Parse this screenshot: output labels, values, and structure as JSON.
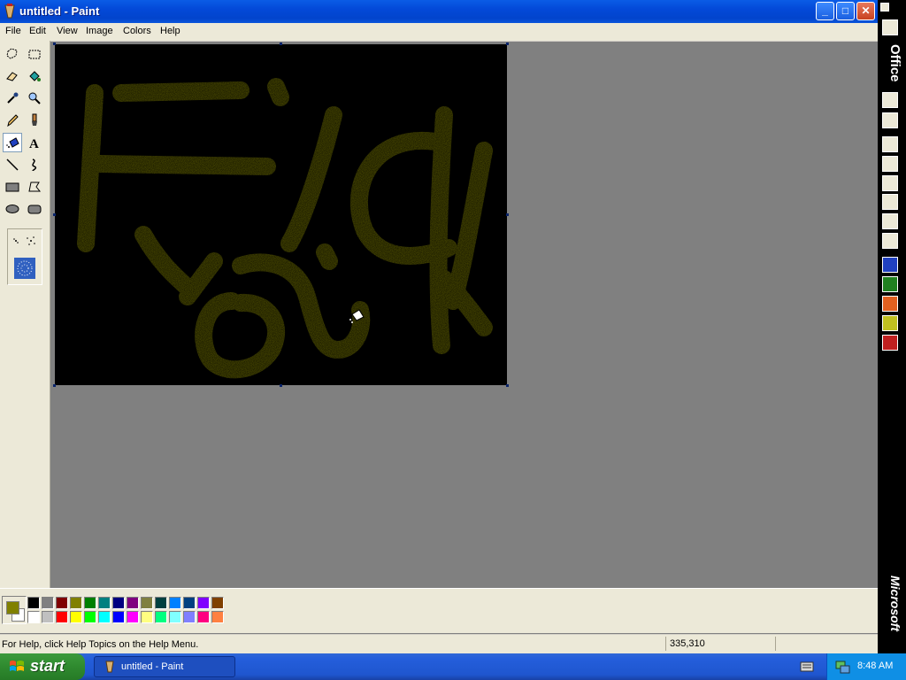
{
  "window": {
    "title": "untitled - Paint",
    "controls": {
      "minimize": "_",
      "maximize": "□",
      "close": "✕"
    }
  },
  "menubar": {
    "items": [
      "File",
      "Edit",
      "View",
      "Image",
      "Colors",
      "Help"
    ]
  },
  "toolbox": {
    "tools": [
      "free-form-select-icon",
      "select-icon",
      "eraser-icon",
      "fill-icon",
      "pick-color-icon",
      "magnifier-icon",
      "pencil-icon",
      "brush-icon",
      "airbrush-icon",
      "text-icon",
      "line-icon",
      "curve-icon",
      "rectangle-icon",
      "polygon-icon",
      "ellipse-icon",
      "rounded-rectangle-icon"
    ],
    "selected_tool": "airbrush-icon"
  },
  "canvas": {
    "background": "#000000",
    "paint_color": "#808000",
    "drawn_text": "Fuck You"
  },
  "colors": {
    "foreground": "#808000",
    "background": "#ffffff",
    "palette_top": [
      "#000000",
      "#808080",
      "#800000",
      "#808000",
      "#008000",
      "#008080",
      "#000080",
      "#800080",
      "#808040",
      "#004040",
      "#0080ff",
      "#004080",
      "#8000ff",
      "#804000"
    ],
    "palette_bottom": [
      "#ffffff",
      "#c0c0c0",
      "#ff0000",
      "#ffff00",
      "#00ff00",
      "#00ffff",
      "#0000ff",
      "#ff00ff",
      "#ffff80",
      "#00ff80",
      "#80ffff",
      "#8080ff",
      "#ff0080",
      "#ff8040"
    ]
  },
  "statusbar": {
    "help_text": "For Help, click Help Topics on the Help Menu.",
    "coordinates": "335,310"
  },
  "officebar": {
    "label": "Office",
    "brand": "Microsoft"
  },
  "taskbar": {
    "start_label": "start",
    "task_label": "untitled - Paint",
    "clock": "8:48 AM"
  }
}
